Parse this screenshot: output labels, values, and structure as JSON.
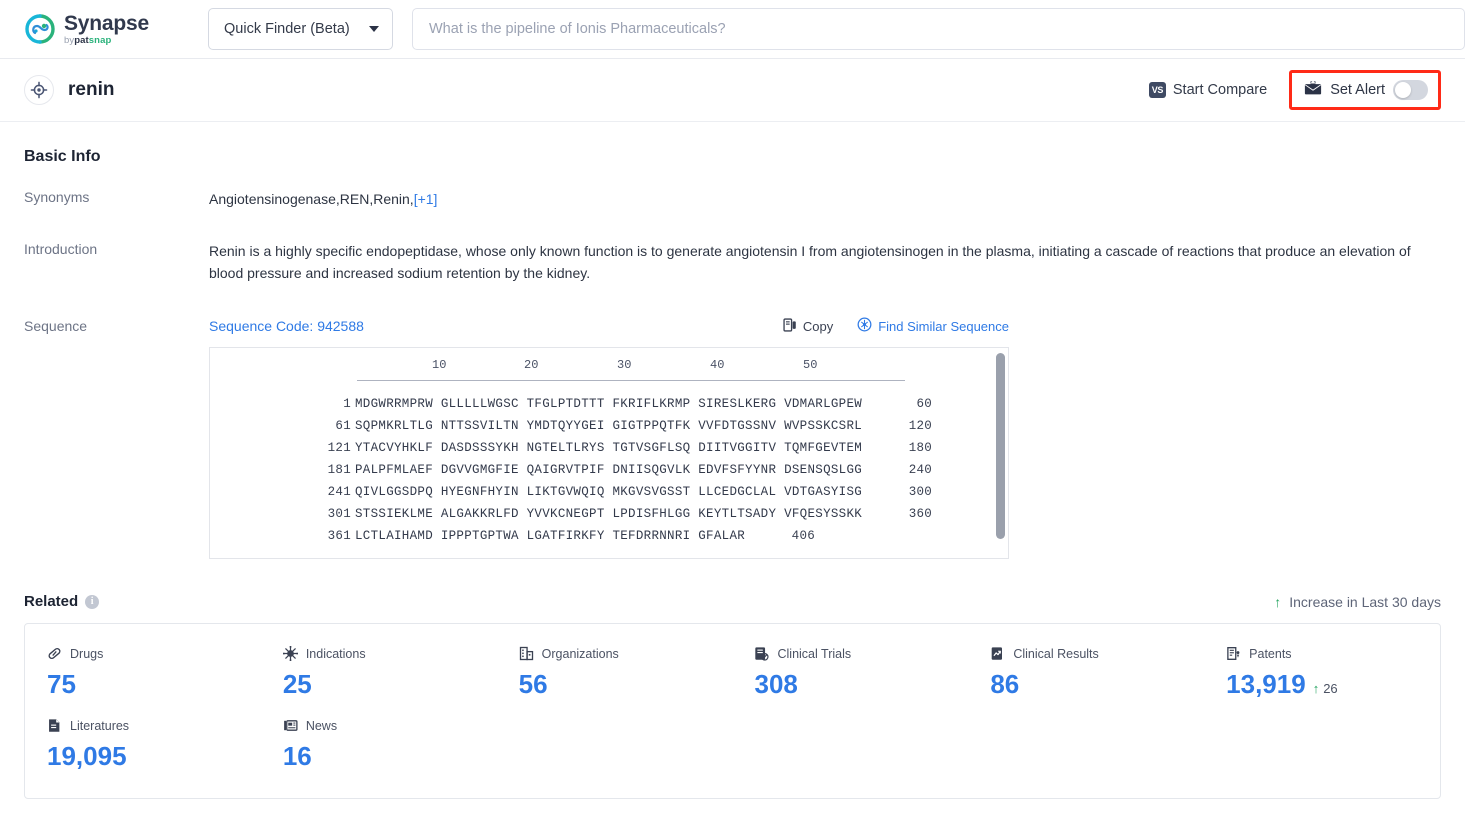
{
  "brand": {
    "title": "Synapse",
    "by": "by",
    "pat": "pat",
    "snap": "snap"
  },
  "topbar": {
    "finder_label": "Quick Finder (Beta)",
    "search_placeholder": "What is the pipeline of Ionis Pharmaceuticals?",
    "search_value": ""
  },
  "subheader": {
    "entity_name": "renin",
    "start_compare": "Start Compare",
    "vs_badge": "VS",
    "set_alert": "Set Alert",
    "alert_on": false
  },
  "basic_info": {
    "heading": "Basic Info",
    "synonyms_label": "Synonyms",
    "synonyms_value": "Angiotensinogenase,REN,Renin,",
    "synonyms_more": "[+1]",
    "introduction_label": "Introduction",
    "introduction_value": "Renin is a highly specific endopeptidase, whose only known function is to generate angiotensin I from angiotensinogen in the plasma, initiating a cascade of reactions that produce an elevation of blood pressure and increased sodium retention by the kidney.",
    "sequence_label": "Sequence",
    "sequence_code": "Sequence Code: 942588",
    "copy_label": "Copy",
    "find_similar_label": "Find Similar Sequence"
  },
  "sequence": {
    "ruler_ticks": [
      "10",
      "20",
      "30",
      "40",
      "50"
    ],
    "rows": [
      {
        "start": "1",
        "blocks": "MDGWRRMPRW GLLLLLWGSC TFGLPTDTTT FKRIFLKRMP SIRESLKERG VDMARLGPEW",
        "end": "60"
      },
      {
        "start": "61",
        "blocks": "SQPMKRLTLG NTTSSVILTN YMDTQYYGEI GIGTPPQTFK VVFDTGSSNV WVPSSKCSRL",
        "end": "120"
      },
      {
        "start": "121",
        "blocks": "YTACVYHKLF DASDSSSYKH NGTELTLRYS TGTVSGFLSQ DIITVGGITV TQMFGEVTEM",
        "end": "180"
      },
      {
        "start": "181",
        "blocks": "PALPFMLAEF DGVVGMGFIE QAIGRVTPIF DNIISQGVLK EDVFSFYYNR DSENSQSLGG",
        "end": "240"
      },
      {
        "start": "241",
        "blocks": "QIVLGGSDPQ HYEGNFHYIN LIKTGVWQIQ MKGVSVGSST LLCEDGCLAL VDTGASYISG",
        "end": "300"
      },
      {
        "start": "301",
        "blocks": "STSSIEKLME ALGAKKRLFD YVVKCNEGPT LPDISFHLGG KEYTLTSADY VFQESYSSKK",
        "end": "360"
      },
      {
        "start": "361",
        "blocks": "LCTLAIHAMD IPPPTGPTWA LGATFIRKFY TEFDRRNNRI GFALAR",
        "end": "406"
      }
    ]
  },
  "related": {
    "title": "Related",
    "info_glyph": "i",
    "increase_note": "Increase in Last 30 days",
    "up_glyph": "↑",
    "metrics": [
      {
        "icon": "pill-icon",
        "label": "Drugs",
        "value": "75",
        "delta": ""
      },
      {
        "icon": "virus-icon",
        "label": "Indications",
        "value": "25",
        "delta": ""
      },
      {
        "icon": "building-icon",
        "label": "Organizations",
        "value": "56",
        "delta": ""
      },
      {
        "icon": "clinical-trial-icon",
        "label": "Clinical Trials",
        "value": "308",
        "delta": ""
      },
      {
        "icon": "clinical-result-icon",
        "label": "Clinical Results",
        "value": "86",
        "delta": ""
      },
      {
        "icon": "patent-icon",
        "label": "Patents",
        "value": "13,919",
        "delta": "26"
      },
      {
        "icon": "literature-icon",
        "label": "Literatures",
        "value": "19,095",
        "delta": ""
      },
      {
        "icon": "news-icon",
        "label": "News",
        "value": "16",
        "delta": ""
      }
    ]
  },
  "colors": {
    "accent_blue": "#2f7ae5",
    "alert_outline": "#ff2a17",
    "increase_green": "#27a562",
    "navy": "#3f4a63"
  }
}
